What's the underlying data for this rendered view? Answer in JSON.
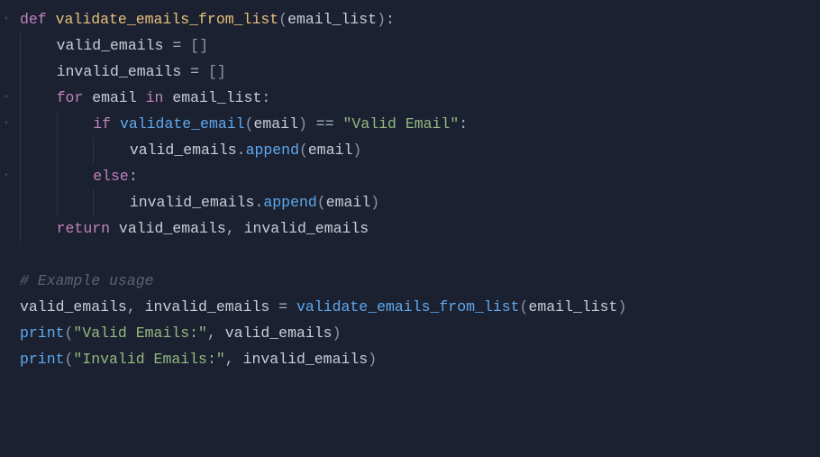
{
  "code": {
    "lines": [
      {
        "fold": true,
        "indent": 0,
        "tokens": [
          [
            "kw",
            "def "
          ],
          [
            "fn",
            "validate_emails_from_list"
          ],
          [
            "punc",
            "("
          ],
          [
            "param",
            "email_list"
          ],
          [
            "punc",
            ")"
          ],
          [
            "op",
            ":"
          ]
        ]
      },
      {
        "fold": false,
        "indent": 1,
        "tokens": [
          [
            "name",
            "valid_emails "
          ],
          [
            "op",
            "="
          ],
          [
            "name",
            " "
          ],
          [
            "punc",
            "["
          ],
          [
            "punc",
            "]"
          ]
        ]
      },
      {
        "fold": false,
        "indent": 1,
        "tokens": [
          [
            "name",
            "invalid_emails "
          ],
          [
            "op",
            "="
          ],
          [
            "name",
            " "
          ],
          [
            "punc",
            "["
          ],
          [
            "punc",
            "]"
          ]
        ]
      },
      {
        "fold": true,
        "indent": 1,
        "tokens": [
          [
            "kw",
            "for"
          ],
          [
            "name",
            " email "
          ],
          [
            "kw",
            "in"
          ],
          [
            "name",
            " email_list"
          ],
          [
            "op",
            ":"
          ]
        ]
      },
      {
        "fold": true,
        "indent": 2,
        "tokens": [
          [
            "kw",
            "if"
          ],
          [
            "name",
            " "
          ],
          [
            "call",
            "validate_email"
          ],
          [
            "punc",
            "("
          ],
          [
            "name",
            "email"
          ],
          [
            "punc",
            ")"
          ],
          [
            "name",
            " "
          ],
          [
            "op",
            "=="
          ],
          [
            "name",
            " "
          ],
          [
            "str",
            "\"Valid Email\""
          ],
          [
            "op",
            ":"
          ]
        ]
      },
      {
        "fold": false,
        "indent": 3,
        "tokens": [
          [
            "name",
            "valid_emails"
          ],
          [
            "op",
            "."
          ],
          [
            "call",
            "append"
          ],
          [
            "punc",
            "("
          ],
          [
            "name",
            "email"
          ],
          [
            "punc",
            ")"
          ]
        ]
      },
      {
        "fold": true,
        "indent": 2,
        "tokens": [
          [
            "kw",
            "else"
          ],
          [
            "op",
            ":"
          ]
        ]
      },
      {
        "fold": false,
        "indent": 3,
        "tokens": [
          [
            "name",
            "invalid_emails"
          ],
          [
            "op",
            "."
          ],
          [
            "call",
            "append"
          ],
          [
            "punc",
            "("
          ],
          [
            "name",
            "email"
          ],
          [
            "punc",
            ")"
          ]
        ]
      },
      {
        "fold": false,
        "indent": 1,
        "tokens": [
          [
            "kw",
            "return"
          ],
          [
            "name",
            " valid_emails"
          ],
          [
            "op",
            ","
          ],
          [
            "name",
            " invalid_emails"
          ]
        ]
      },
      {
        "fold": false,
        "indent": 0,
        "tokens": []
      },
      {
        "fold": false,
        "indent": 0,
        "tokens": [
          [
            "cmt",
            "# Example usage"
          ]
        ]
      },
      {
        "fold": false,
        "indent": 0,
        "tokens": [
          [
            "name",
            "valid_emails"
          ],
          [
            "op",
            ","
          ],
          [
            "name",
            " invalid_emails "
          ],
          [
            "op",
            "="
          ],
          [
            "name",
            " "
          ],
          [
            "call",
            "validate_emails_from_list"
          ],
          [
            "punc",
            "("
          ],
          [
            "name",
            "email_list"
          ],
          [
            "punc",
            ")"
          ]
        ]
      },
      {
        "fold": false,
        "indent": 0,
        "tokens": [
          [
            "builtin",
            "print"
          ],
          [
            "punc",
            "("
          ],
          [
            "str",
            "\"Valid Emails:\""
          ],
          [
            "op",
            ","
          ],
          [
            "name",
            " valid_emails"
          ],
          [
            "punc",
            ")"
          ]
        ]
      },
      {
        "fold": false,
        "indent": 0,
        "tokens": [
          [
            "builtin",
            "print"
          ],
          [
            "punc",
            "("
          ],
          [
            "str",
            "\"Invalid Emails:\""
          ],
          [
            "op",
            ","
          ],
          [
            "name",
            " invalid_emails"
          ],
          [
            "punc",
            ")"
          ]
        ]
      }
    ],
    "indent_unit": "    ",
    "fold_glyph": "▾"
  }
}
